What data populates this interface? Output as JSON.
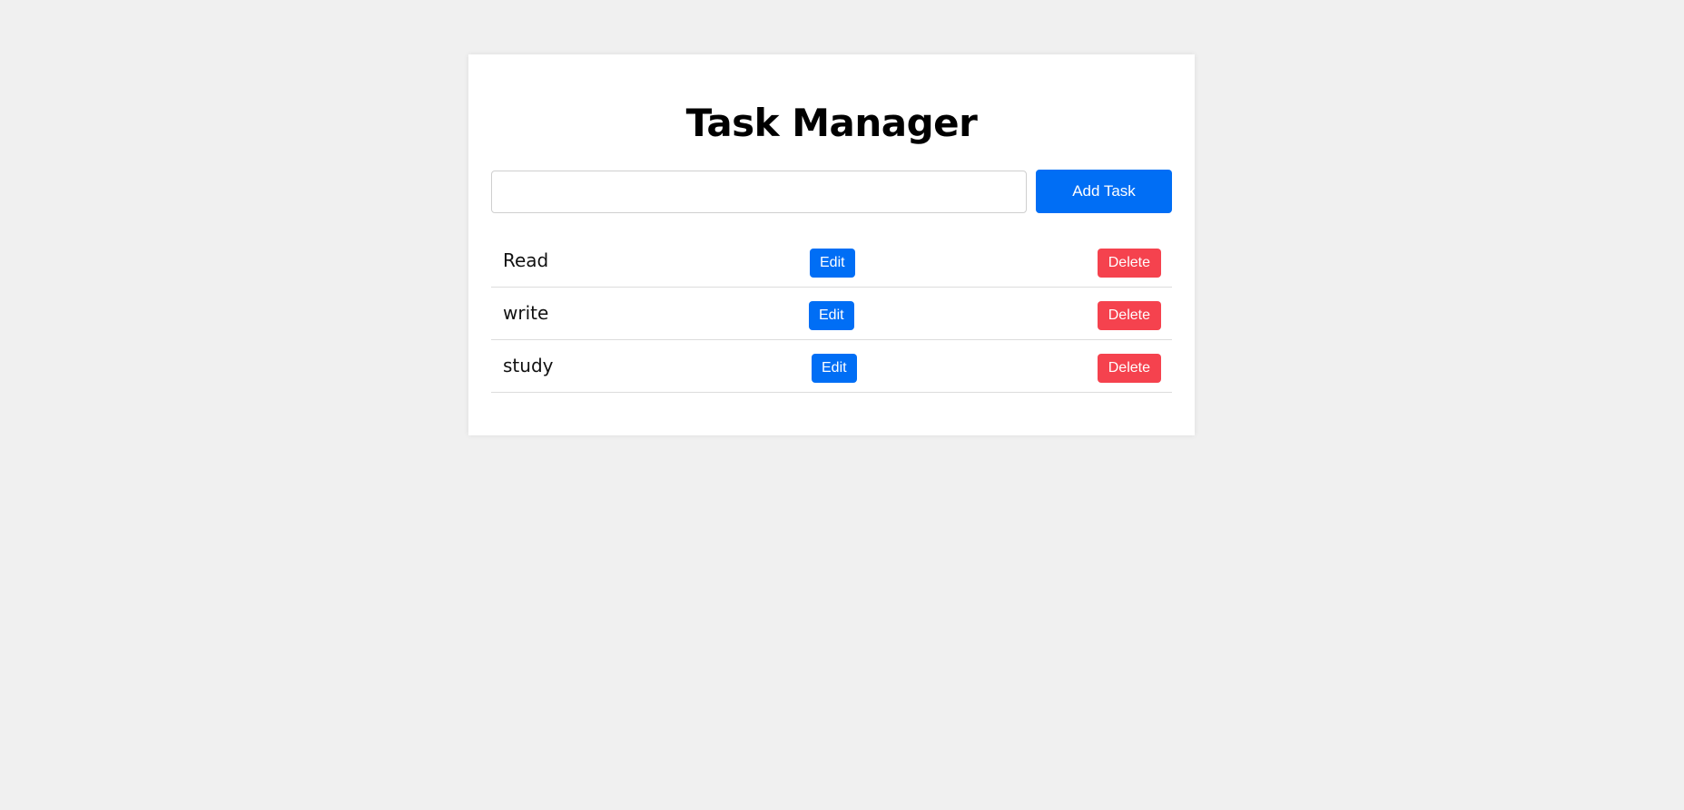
{
  "app": {
    "title": "Task Manager"
  },
  "add_task": {
    "input_value": "",
    "input_placeholder": "",
    "button_label": "Add Task"
  },
  "tasks": [
    {
      "text": "Read",
      "edit_label": "Edit",
      "delete_label": "Delete"
    },
    {
      "text": "write",
      "edit_label": "Edit",
      "delete_label": "Delete"
    },
    {
      "text": "study",
      "edit_label": "Edit",
      "delete_label": "Delete"
    }
  ],
  "colors": {
    "primary": "#006ef5",
    "danger": "#f5424e",
    "background": "#f0f0f0",
    "card": "#ffffff"
  }
}
